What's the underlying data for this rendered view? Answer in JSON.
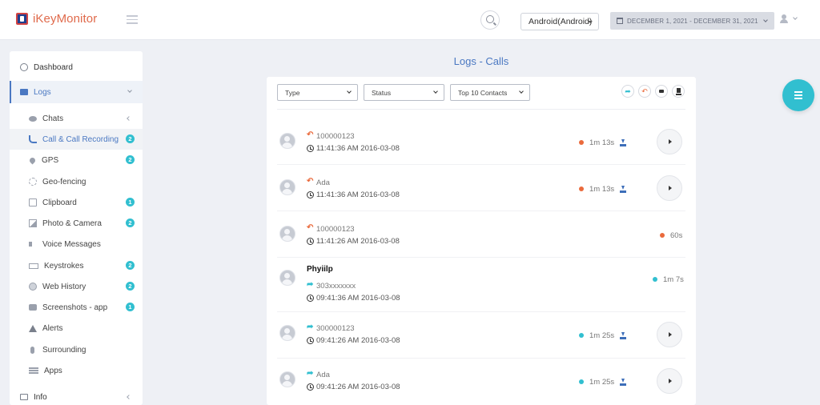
{
  "header": {
    "app_name": "iKeyMonitor",
    "device": "Android(Android)",
    "date_range": "DECEMBER 1, 2021 - DECEMBER 31, 2021"
  },
  "sidebar": {
    "dashboard": "Dashboard",
    "logs": "Logs",
    "info": "Info",
    "items": [
      {
        "label": "Chats",
        "icon": "chat-icon",
        "badge": ""
      },
      {
        "label": "Call & Call Recording",
        "icon": "phone-icon",
        "badge": "2"
      },
      {
        "label": "GPS",
        "icon": "map-pin-icon",
        "badge": "2"
      },
      {
        "label": "Geo-fencing",
        "icon": "geofence-icon",
        "badge": ""
      },
      {
        "label": "Clipboard",
        "icon": "clipboard-icon",
        "badge": "1"
      },
      {
        "label": "Photo & Camera",
        "icon": "photo-icon",
        "badge": "2"
      },
      {
        "label": "Voice Messages",
        "icon": "volume-icon",
        "badge": ""
      },
      {
        "label": "Keystrokes",
        "icon": "keyboard-icon",
        "badge": "2"
      },
      {
        "label": "Web History",
        "icon": "globe-icon",
        "badge": "2"
      },
      {
        "label": "Screenshots - app",
        "icon": "camera-icon",
        "badge": "1"
      },
      {
        "label": "Alerts",
        "icon": "alert-icon",
        "badge": ""
      },
      {
        "label": "Surrounding",
        "icon": "microphone-icon",
        "badge": ""
      },
      {
        "label": "Apps",
        "icon": "apps-icon",
        "badge": ""
      }
    ]
  },
  "main": {
    "title": "Logs - Calls",
    "filters": {
      "type": "Type",
      "status": "Status",
      "contacts": "Top 10 Contacts"
    },
    "calls": [
      {
        "name": "",
        "number": "100000123",
        "direction": "incoming",
        "time": "11:41:36 AM 2016-03-08",
        "duration": "1m 13s",
        "recording": true
      },
      {
        "name": "",
        "number": "Ada",
        "direction": "incoming",
        "time": "11:41:36 AM 2016-03-08",
        "duration": "1m 13s",
        "recording": true
      },
      {
        "name": "",
        "number": "100000123",
        "direction": "incoming",
        "time": "11:41:26 AM 2016-03-08",
        "duration": "60s",
        "recording": false
      },
      {
        "name": "Phyiilp",
        "number": "303xxxxxxx",
        "direction": "outgoing",
        "time": "09:41:36 AM 2016-03-08",
        "duration": "1m 7s",
        "recording": false
      },
      {
        "name": "",
        "number": "300000123",
        "direction": "outgoing",
        "time": "09:41:26 AM 2016-03-08",
        "duration": "1m 25s",
        "recording": true
      },
      {
        "name": "",
        "number": "Ada",
        "direction": "outgoing",
        "time": "09:41:26 AM 2016-03-08",
        "duration": "1m 25s",
        "recording": true
      }
    ]
  },
  "colors": {
    "accent": "#31bfd0",
    "primary": "#4a78c2",
    "incoming": "#ea6a3c",
    "outgoing": "#31bfd0"
  }
}
